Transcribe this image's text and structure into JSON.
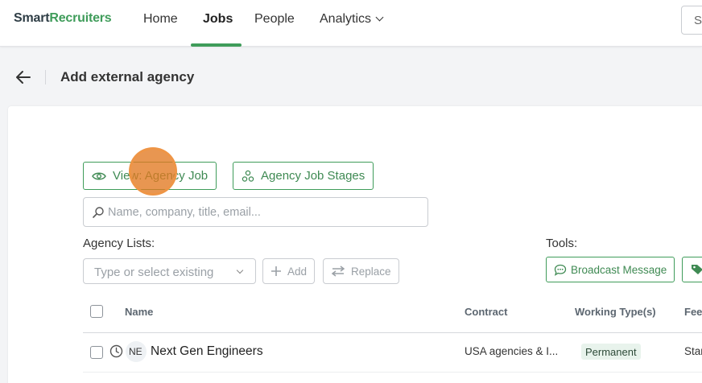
{
  "brand": {
    "part1": "Smart",
    "part2": "Recruiters",
    "accent_color": "#3f9c5a"
  },
  "nav": {
    "items": [
      {
        "label": "Home"
      },
      {
        "label": "Jobs"
      },
      {
        "label": "People"
      },
      {
        "label": "Analytics"
      }
    ],
    "active": "Jobs",
    "search_partial": "S"
  },
  "page": {
    "title": "Add external agency",
    "back_icon": "arrow-left-icon"
  },
  "buttons": {
    "view_agency_job": "View: Agency Job",
    "agency_job_stages": "Agency Job Stages"
  },
  "search": {
    "placeholder": "Name, company, title, email..."
  },
  "agency_lists": {
    "label": "Agency Lists:",
    "select_placeholder": "Type or select existing",
    "add_label": "Add",
    "replace_label": "Replace"
  },
  "tools": {
    "label": "Tools:",
    "broadcast_label": "Broadcast Message",
    "tag_icon": "tag-icon"
  },
  "table": {
    "headers": [
      "Name",
      "Contract",
      "Working Type(s)",
      "Fee"
    ],
    "rows": [
      {
        "initials": "NE",
        "name": "Next Gen Engineers",
        "contract": "USA agencies & I...",
        "working_type": "Permanent",
        "fee": "Star"
      }
    ]
  },
  "cursor_color": "#e27820"
}
